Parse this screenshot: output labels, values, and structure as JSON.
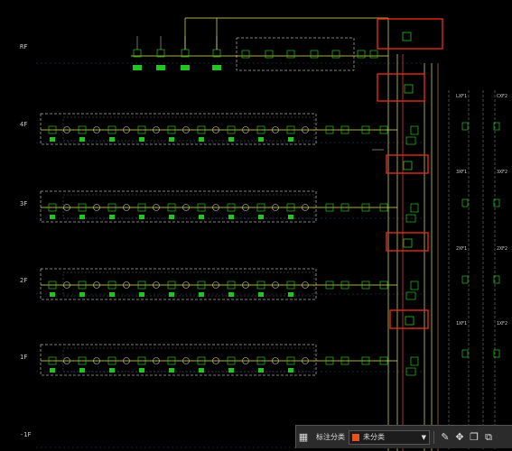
{
  "floors": [
    {
      "key": "rf",
      "label": "RF"
    },
    {
      "key": "f4",
      "label": "4F"
    },
    {
      "key": "f3",
      "label": "3F"
    },
    {
      "key": "f2",
      "label": "2F"
    },
    {
      "key": "f1",
      "label": "1F"
    },
    {
      "key": "b1",
      "label": "-1F"
    }
  ],
  "panel_labels": [
    "LXF1",
    "CXF2",
    "3XF1",
    "3XF2",
    "2XF1",
    "2XF2",
    "1XF1",
    "1XF2"
  ],
  "colors": {
    "highlight": "#e02a1a",
    "device": "#22c422",
    "wire": "#e8e84a",
    "dash": "#ffffff",
    "accent": "#ff6020"
  },
  "toolbar": {
    "label": "标注分类",
    "category_value": "未分类",
    "category_color": "#e8521f",
    "icons": [
      "grid-icon",
      "edit-icon",
      "move-icon",
      "copy-icon",
      "duplicate-icon"
    ]
  }
}
